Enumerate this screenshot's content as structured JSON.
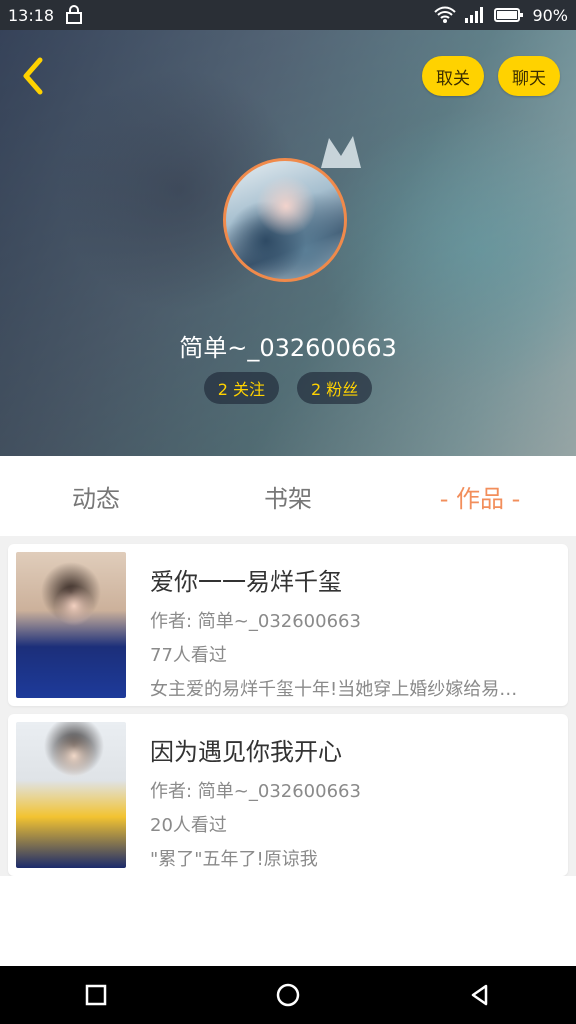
{
  "status_bar": {
    "time": "13:18",
    "battery_percent": "90%",
    "icons": [
      "lock-icon",
      "wifi-icon",
      "signal-icon",
      "battery-icon"
    ]
  },
  "header": {
    "back_icon": "chevron-left-icon",
    "unfollow_label": "取关",
    "chat_label": "聊天",
    "username": "简单~_032600663",
    "following": "2 关注",
    "followers": "2 粉丝"
  },
  "tabs": [
    {
      "label": "动态",
      "active": false
    },
    {
      "label": "书架",
      "active": false
    },
    {
      "label": "- 作品 -",
      "active": true
    }
  ],
  "works": [
    {
      "title": "爱你一一易烊千玺",
      "author": "作者: 简单~_032600663",
      "views": "77人看过",
      "description": "女主爱的易烊千玺十年!当她穿上婚纱嫁给易…"
    },
    {
      "title": "因为遇见你我开心",
      "author": "作者: 简单~_032600663",
      "views": "20人看过",
      "description": "\"累了\"五年了!原谅我"
    }
  ],
  "colors": {
    "accent_yellow": "#ffd200",
    "active_tab": "#f28e5b",
    "avatar_ring": "#f08a4b"
  },
  "nav": {
    "buttons": [
      "square-recents-icon",
      "circle-home-icon",
      "triangle-back-icon"
    ]
  }
}
